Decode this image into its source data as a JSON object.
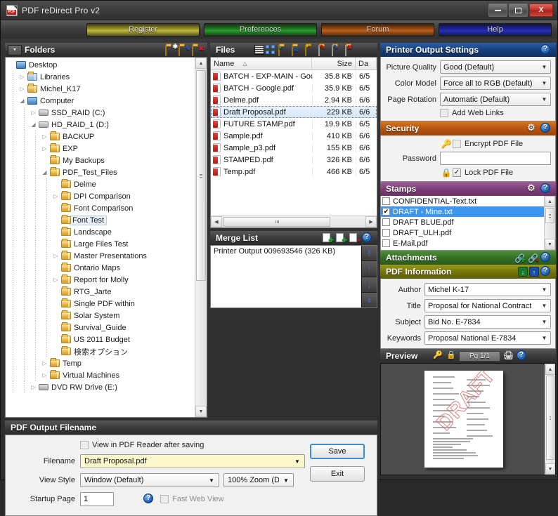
{
  "window": {
    "title": "PDF reDirect Pro v2",
    "app_icon": "pdf-file-icon",
    "minimize": "minimize-icon",
    "maximize": "maximize-icon",
    "close": "X"
  },
  "nav": {
    "buttons": [
      {
        "label": "Register",
        "color": "#b5ae33"
      },
      {
        "label": "Preferences",
        "color": "#23a02b"
      },
      {
        "label": "Forum",
        "color": "#c2601a"
      },
      {
        "label": "Help",
        "color": "#2630c4"
      }
    ]
  },
  "folders": {
    "title": "Folders",
    "toolbar": [
      "new-folder-icon",
      "rename-folder-icon",
      "delete-folder-icon"
    ],
    "tree": [
      {
        "label": "Desktop",
        "indent": 0,
        "expander": "",
        "icon": "desktop-icon"
      },
      {
        "label": "Libraries",
        "indent": 1,
        "expander": "▷",
        "icon": "library-icon"
      },
      {
        "label": "Michel_K17",
        "indent": 1,
        "expander": "▷",
        "icon": "user-icon"
      },
      {
        "label": "Computer",
        "indent": 1,
        "expander": "◢",
        "icon": "computer-icon"
      },
      {
        "label": "SSD_RAID (C:)",
        "indent": 2,
        "expander": "▷",
        "icon": "drive-icon"
      },
      {
        "label": "HD_RAID_1 (D:)",
        "indent": 2,
        "expander": "◢",
        "icon": "drive-icon"
      },
      {
        "label": "BACKUP",
        "indent": 3,
        "expander": "▷",
        "icon": "folder-icon"
      },
      {
        "label": "EXP",
        "indent": 3,
        "expander": "▷",
        "icon": "folder-icon"
      },
      {
        "label": "My Backups",
        "indent": 3,
        "expander": "",
        "icon": "folder-icon"
      },
      {
        "label": "PDF_Test_Files",
        "indent": 3,
        "expander": "◢",
        "icon": "folder-icon"
      },
      {
        "label": "Delme",
        "indent": 4,
        "expander": "",
        "icon": "folder-icon"
      },
      {
        "label": "DPI Comparison",
        "indent": 4,
        "expander": "▷",
        "icon": "folder-icon"
      },
      {
        "label": "Font Comparison",
        "indent": 4,
        "expander": "",
        "icon": "folder-icon"
      },
      {
        "label": "Font Test",
        "indent": 4,
        "expander": "",
        "icon": "folder-icon",
        "selected": true
      },
      {
        "label": "Landscape",
        "indent": 4,
        "expander": "",
        "icon": "folder-icon"
      },
      {
        "label": "Large Files Test",
        "indent": 4,
        "expander": "",
        "icon": "folder-icon"
      },
      {
        "label": "Master Presentations",
        "indent": 4,
        "expander": "▷",
        "icon": "folder-icon"
      },
      {
        "label": "Ontario Maps",
        "indent": 4,
        "expander": "",
        "icon": "folder-icon"
      },
      {
        "label": "Report for Molly",
        "indent": 4,
        "expander": "▷",
        "icon": "folder-icon"
      },
      {
        "label": "RTG_Jarte",
        "indent": 4,
        "expander": "",
        "icon": "folder-icon"
      },
      {
        "label": "Single PDF within",
        "indent": 4,
        "expander": "",
        "icon": "folder-icon"
      },
      {
        "label": "Solar System",
        "indent": 4,
        "expander": "",
        "icon": "folder-icon"
      },
      {
        "label": "Survival_Guide",
        "indent": 4,
        "expander": "",
        "icon": "folder-icon"
      },
      {
        "label": "US 2011 Budget",
        "indent": 4,
        "expander": "",
        "icon": "folder-icon"
      },
      {
        "label": "検索オプション",
        "indent": 4,
        "expander": "",
        "icon": "folder-icon"
      },
      {
        "label": "Temp",
        "indent": 3,
        "expander": "▷",
        "icon": "folder-icon"
      },
      {
        "label": "Virtual Machines",
        "indent": 3,
        "expander": "▷",
        "icon": "folder-icon"
      },
      {
        "label": "DVD RW Drive (E:)",
        "indent": 2,
        "expander": "▷",
        "icon": "drive-icon"
      }
    ]
  },
  "files": {
    "title": "Files",
    "toolbar": [
      "list-view-icon",
      "icon-view-icon",
      "browse-folder-icon",
      "email-folder-icon",
      "open-file-icon",
      "edit-file-icon",
      "rename-file-icon",
      "delete-file-icon"
    ],
    "columns": {
      "name": "Name",
      "size": "Size",
      "date": "Da",
      "sort": "△"
    },
    "rows": [
      {
        "name": "BATCH - EXP-MAIN - Goo…",
        "size": "35.8 KB",
        "date": "6/5"
      },
      {
        "name": "BATCH - Google.pdf",
        "size": "35.9 KB",
        "date": "6/5"
      },
      {
        "name": "Delme.pdf",
        "size": "2.94 KB",
        "date": "6/6"
      },
      {
        "name": "Draft Proposal.pdf",
        "size": "229 KB",
        "date": "6/6",
        "selected": true
      },
      {
        "name": "FUTURE STAMP.pdf",
        "size": "19.9 KB",
        "date": "6/5"
      },
      {
        "name": "Sample.pdf",
        "size": "410 KB",
        "date": "6/6"
      },
      {
        "name": "Sample_p3.pdf",
        "size": "155 KB",
        "date": "6/6"
      },
      {
        "name": "STAMPED.pdf",
        "size": "326 KB",
        "date": "6/6"
      },
      {
        "name": "Temp.pdf",
        "size": "466 KB",
        "date": "6/5"
      }
    ]
  },
  "merge": {
    "title": "Merge List",
    "toolbar": [
      "add-file-icon",
      "add-all-icon",
      "remove-file-icon",
      "help-icon"
    ],
    "items": [
      "Printer Output 009693546 (326 KB)"
    ],
    "arrows": [
      "move-to-top",
      "move-up",
      "move-down",
      "move-to-bottom"
    ]
  },
  "printer_output": {
    "title": "Printer Output Settings",
    "picture_quality_label": "Picture Quality",
    "picture_quality_value": "Good (Default)",
    "color_model_label": "Color Model",
    "color_model_value": "Force all  to RGB (Default)",
    "page_rotation_label": "Page Rotation",
    "page_rotation_value": "Automatic (Default)",
    "add_web_links_label": "Add Web Links",
    "add_web_links_checked": false
  },
  "security": {
    "title": "Security",
    "encrypt_label": "Encrypt PDF File",
    "encrypt_checked": false,
    "password_label": "Password",
    "password_value": "",
    "lock_label": "Lock PDF File",
    "lock_checked": true
  },
  "stamps": {
    "title": "Stamps",
    "items": [
      {
        "label": "CONFIDENTIAL-Text.txt",
        "checked": false,
        "selected": false
      },
      {
        "label": "DRAFT - Mine.txt",
        "checked": true,
        "selected": true
      },
      {
        "label": "DRAFT BLUE.pdf",
        "checked": false,
        "selected": false
      },
      {
        "label": "DRAFT_ULH.pdf",
        "checked": false,
        "selected": false
      },
      {
        "label": "E-Mail.pdf",
        "checked": false,
        "selected": false
      }
    ]
  },
  "attachments": {
    "title": "Attachments",
    "toolbar": [
      "add-attachment-icon",
      "remove-attachment-icon",
      "help-icon"
    ]
  },
  "pdf_information": {
    "title": "PDF Information",
    "toolbar": [
      "info-download-icon",
      "info-upload-icon",
      "help-icon"
    ],
    "author_label": "Author",
    "author_value": "Michel K-17",
    "title_label": "Title",
    "title_value": "Proposal for National Contract",
    "subject_label": "Subject",
    "subject_value": "Bid No. E-7834",
    "keywords_label": "Keywords",
    "keywords_value": "Proposal National E-7834"
  },
  "preview": {
    "title": "Preview",
    "page_label": "Pg 1/1",
    "watermark": "DRAFT",
    "toolbar": [
      "key-icon",
      "lock-icon",
      "print-icon",
      "help-icon"
    ]
  },
  "output": {
    "title": "PDF Output Filename",
    "view_after_label": "View in PDF Reader after saving",
    "view_after_checked": false,
    "filename_label": "Filename",
    "filename_value": "Draft Proposal.pdf",
    "view_style_label": "View Style",
    "view_style_value": "Window (Default)",
    "zoom_value": "100% Zoom (De",
    "startup_page_label": "Startup Page",
    "startup_page_value": "1",
    "fast_web_label": "Fast Web View",
    "fast_web_checked": false,
    "save_label": "Save",
    "exit_label": "Exit"
  }
}
